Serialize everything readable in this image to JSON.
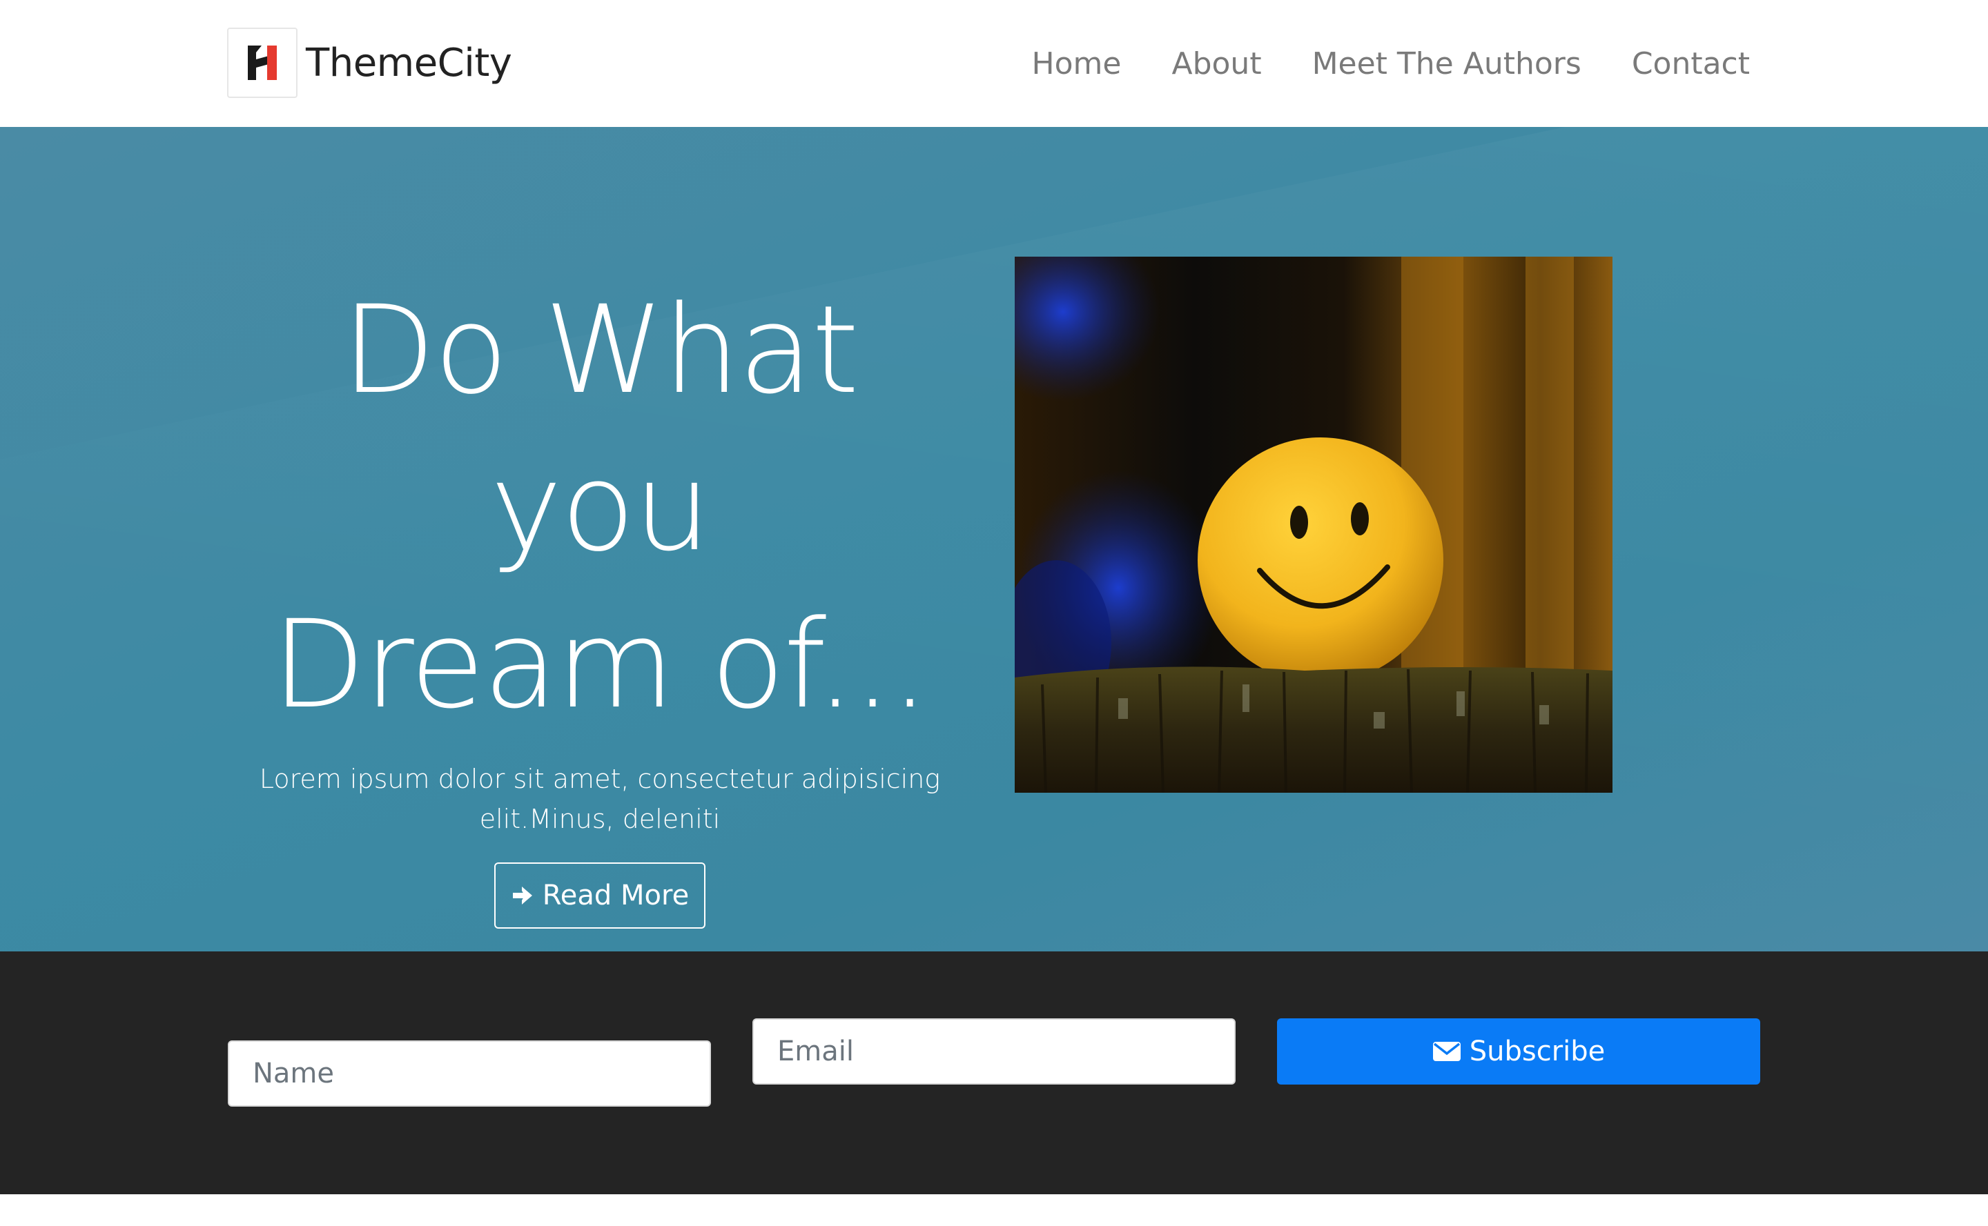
{
  "brand": {
    "name": "ThemeCity",
    "logo_icon": "h-logo-icon",
    "colors": {
      "dark": "#1a1a1a",
      "accent": "#e53a2f"
    }
  },
  "nav": {
    "items": [
      {
        "label": "Home"
      },
      {
        "label": "About"
      },
      {
        "label": "Meet The Authors"
      },
      {
        "label": "Contact"
      }
    ]
  },
  "hero": {
    "title_line1": "Do What you",
    "title_line2": "Dream of...",
    "subtitle": "Lorem ipsum dolor sit amet, consectetur adipisicing elit.Minus, deleniti",
    "button_label": "Read More",
    "button_icon": "arrow-right-icon",
    "image_icon": "smiley-ball-photo",
    "background_color": "#3d8aa4"
  },
  "subscribe": {
    "name_placeholder": "Name",
    "email_placeholder": "Email",
    "button_label": "Subscribe",
    "button_icon": "envelope-icon",
    "button_color": "#0a7bf6",
    "background_color": "#242424"
  }
}
